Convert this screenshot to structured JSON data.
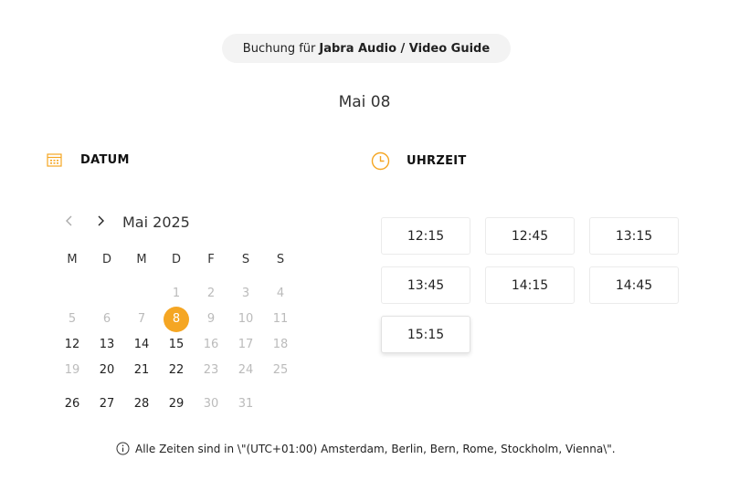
{
  "booking": {
    "prefix": "Buchung für",
    "service": "Jabra Audio / Video Guide"
  },
  "selected_date_label": "Mai 08",
  "date_section": {
    "icon": "calendar-icon",
    "label": "DATUM"
  },
  "time_section": {
    "icon": "clock-icon",
    "label": "UHRZEIT"
  },
  "calendar": {
    "prev_icon": "chevron-left-icon",
    "next_icon": "chevron-right-icon",
    "month_label": "Mai 2025",
    "weekdays": [
      "M",
      "D",
      "M",
      "D",
      "F",
      "S",
      "S"
    ],
    "weeks": [
      [
        {
          "d": ""
        },
        {
          "d": ""
        },
        {
          "d": ""
        },
        {
          "d": "1",
          "state": "disabled"
        },
        {
          "d": "2",
          "state": "disabled"
        },
        {
          "d": "3",
          "state": "disabled"
        },
        {
          "d": "4",
          "state": "disabled"
        }
      ],
      [
        {
          "d": "5",
          "state": "disabled"
        },
        {
          "d": "6",
          "state": "disabled"
        },
        {
          "d": "7",
          "state": "disabled"
        },
        {
          "d": "8",
          "state": "selected"
        },
        {
          "d": "9",
          "state": "disabled"
        },
        {
          "d": "10",
          "state": "disabled"
        },
        {
          "d": "11",
          "state": "disabled"
        }
      ],
      [
        {
          "d": "12",
          "state": "available"
        },
        {
          "d": "13",
          "state": "available"
        },
        {
          "d": "14",
          "state": "available"
        },
        {
          "d": "15",
          "state": "available"
        },
        {
          "d": "16",
          "state": "disabled"
        },
        {
          "d": "17",
          "state": "disabled"
        },
        {
          "d": "18",
          "state": "disabled"
        }
      ],
      [
        {
          "d": "19",
          "state": "disabled"
        },
        {
          "d": "20",
          "state": "available"
        },
        {
          "d": "21",
          "state": "available"
        },
        {
          "d": "22",
          "state": "available"
        },
        {
          "d": "23",
          "state": "disabled"
        },
        {
          "d": "24",
          "state": "disabled"
        },
        {
          "d": "25",
          "state": "disabled"
        }
      ],
      [
        {
          "d": "26",
          "state": "available"
        },
        {
          "d": "27",
          "state": "available"
        },
        {
          "d": "28",
          "state": "available"
        },
        {
          "d": "29",
          "state": "available"
        },
        {
          "d": "30",
          "state": "disabled"
        },
        {
          "d": "31",
          "state": "disabled"
        },
        {
          "d": ""
        }
      ]
    ]
  },
  "time_slots": [
    "12:15",
    "12:45",
    "13:15",
    "13:45",
    "14:15",
    "14:45",
    "15:15"
  ],
  "timezone_note": {
    "icon": "info-icon",
    "text": "Alle Zeiten sind in \\\"(UTC+01:00) Amsterdam, Berlin, Bern, Rome, Stockholm, Vienna\\\"."
  },
  "colors": {
    "accent": "#f5a623",
    "muted_text": "#bbbbbb",
    "pill_bg": "#f3f3f3"
  }
}
